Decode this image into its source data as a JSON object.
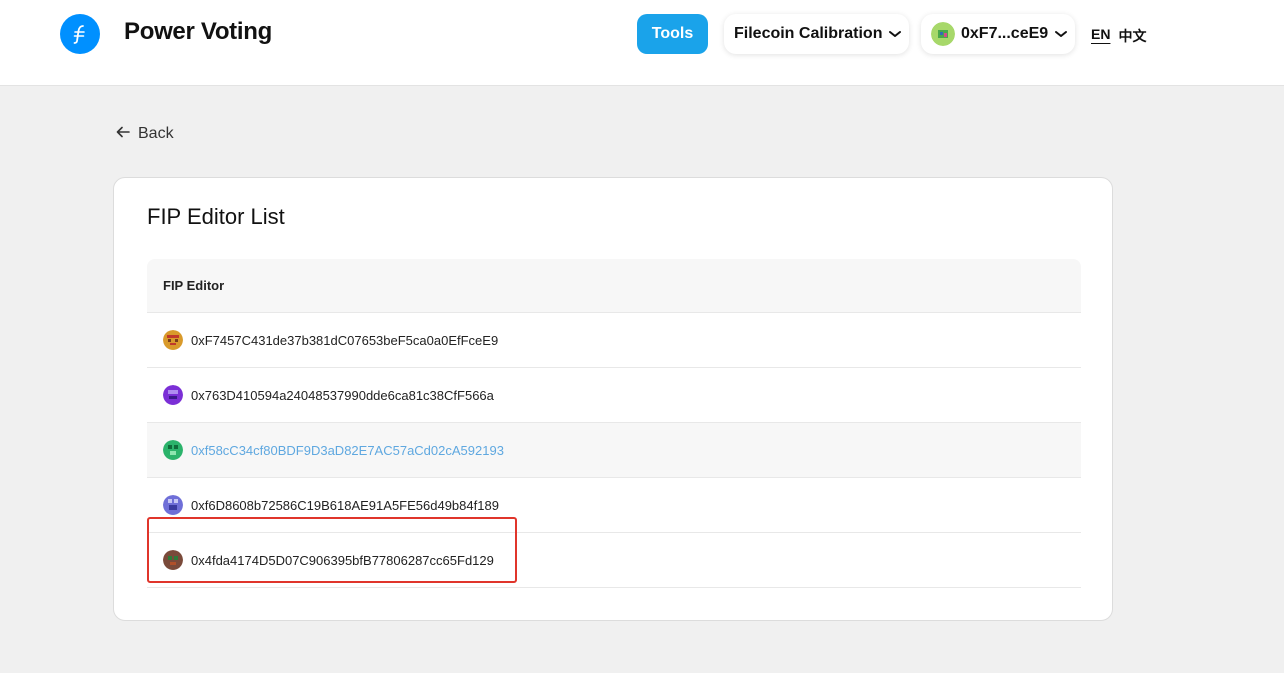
{
  "header": {
    "app_title": "Power Voting",
    "tools_label": "Tools",
    "network_label": "Filecoin Calibration",
    "account_label": "0xF7...ceE9",
    "lang_en": "EN",
    "lang_zh": "中文"
  },
  "nav": {
    "back_label": "Back"
  },
  "card": {
    "title": "FIP Editor List",
    "column_header": "FIP Editor",
    "rows": [
      {
        "address": "0xF7457C431de37b381dC07653beF5ca0a0EfFceE9",
        "avatar_color": "#d99a2b"
      },
      {
        "address": "0x763D410594a24048537990dde6ca81c38CfF566a",
        "avatar_color": "#7b2fd6"
      },
      {
        "address": "0xf58cC34cf80BDF9D3aD82E7AC57aCd02cA592193",
        "avatar_color": "#2bb36b"
      },
      {
        "address": "0xf6D8608b72586C19B618AE91A5FE56d49b84f189",
        "avatar_color": "#6f6fd8"
      },
      {
        "address": "0x4fda4174D5D07C906395bfB77806287cc65Fd129",
        "avatar_color": "#7a4a3a"
      }
    ]
  },
  "colors": {
    "accent": "#1aa3ea",
    "logo": "#0090ff",
    "highlight": "#e0352b",
    "link_hover": "#5fa8e0"
  }
}
